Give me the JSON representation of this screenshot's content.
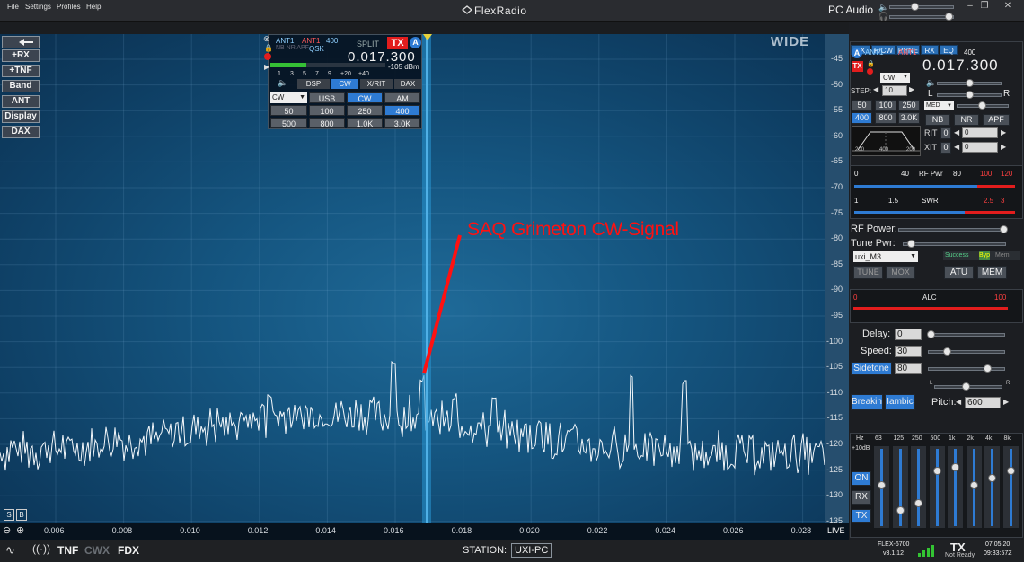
{
  "menu": {
    "file": "File",
    "settings": "Settings",
    "profiles": "Profiles",
    "help": "Help"
  },
  "brand": "FlexRadio",
  "pc_audio": "PC Audio",
  "left_buttons": [
    "+RX",
    "+TNF",
    "Band",
    "ANT",
    "Display",
    "DAX"
  ],
  "panadapter": {
    "mode_label": "WIDE",
    "db_scale": [
      "-45",
      "-50",
      "-55",
      "-60",
      "-65",
      "-70",
      "-75",
      "-80",
      "-85",
      "-90",
      "-95",
      "-100",
      "-105",
      "-110",
      "-115",
      "-120",
      "-125",
      "-130",
      "-135"
    ],
    "freq_axis": [
      "0.006",
      "0.008",
      "0.010",
      "0.012",
      "0.014",
      "0.016",
      "0.018",
      "0.020",
      "0.022",
      "0.024",
      "0.026",
      "0.028"
    ],
    "live": "LIVE",
    "annotation": "SAQ Grimeton CW-Signal",
    "corner_buttons": [
      "S",
      "B"
    ]
  },
  "slice_flag": {
    "ant_rx": "ANT1",
    "ant_tx": "ANT1",
    "filter_width": "400",
    "split": "SPLIT",
    "tx": "TX",
    "letter": "A",
    "indicators": "NB NR APF",
    "qsk": "QSK",
    "frequency": "0.017.300",
    "smeter": "-105 dBm",
    "scale": [
      "1",
      "3",
      "5",
      "7",
      "9",
      "+20",
      "+40"
    ],
    "tabs": [
      "DSP",
      "CW",
      "X/RIT",
      "DAX"
    ],
    "active_tab": "CW",
    "mode_select": "CW",
    "modes": [
      "USB",
      "CW",
      "AM"
    ],
    "active_mode": "CW",
    "filters": [
      "50",
      "100",
      "250",
      "400",
      "500",
      "800",
      "1.0K",
      "3.0K"
    ],
    "active_filter": "400"
  },
  "right_panel": {
    "tabs": [
      "TX",
      "P/CW",
      "PHNE",
      "RX",
      "EQ"
    ],
    "ant_rx": "ANT1",
    "ant_tx": "ANT1",
    "filter_width": "400",
    "letter": "A",
    "tx": "TX",
    "frequency": "0.017.300",
    "mode": "CW",
    "step_label": "STEP:",
    "step_value": "10",
    "agc_label": "MED",
    "pan_l": "L",
    "pan_r": "R",
    "filters": [
      "50",
      "100",
      "250",
      "400",
      "800",
      "3.0K"
    ],
    "active_filter": "400",
    "dsp": [
      "NB",
      "NR",
      "APF"
    ],
    "rit_label": "RIT",
    "rit_on": "0",
    "rit_value": "0",
    "xit_label": "XIT",
    "xit_on": "0",
    "xit_value": "0",
    "filter_graph": [
      "200",
      "400",
      "200"
    ],
    "rfpwr_scale": [
      "0",
      "40",
      "RF Pwr",
      "80",
      "100",
      "120"
    ],
    "swr_scale": [
      "1",
      "1.5",
      "SWR",
      "2.5",
      "3"
    ],
    "rf_power_label": "RF Power:",
    "tune_pwr_label": "Tune Pwr:",
    "profile": "uxi_M3",
    "profile_status": "Success",
    "byp": "Byp",
    "mem": "Mem",
    "tune": "TUNE",
    "mox": "MOX",
    "atu": "ATU",
    "mem_btn": "MEM",
    "alc_min": "0",
    "alc_label": "ALC",
    "alc_max": "100",
    "delay_label": "Delay:",
    "delay_value": "0",
    "speed_label": "Speed:",
    "speed_value": "30",
    "sidetone_btn": "Sidetone",
    "sidetone_value": "80",
    "l": "L",
    "r": "R",
    "breakin": "Breakin",
    "iambic": "Iambic",
    "pitch_label": "Pitch:",
    "pitch_value": "600",
    "eq_hz": "Hz",
    "eq_bands": [
      "63",
      "125",
      "250",
      "500",
      "1k",
      "2k",
      "4k",
      "8k"
    ],
    "eq_db": "+10dB",
    "eq_on": "ON",
    "eq_rx": "RX",
    "eq_tx": "TX",
    "eq_levels": [
      0.55,
      0.2,
      0.3,
      0.75,
      0.8,
      0.55,
      0.65,
      0.75
    ]
  },
  "status": {
    "tnf": "TNF",
    "cwx": "CWX",
    "fdx": "FDX",
    "station_label": "STATION:",
    "station": "UXI-PC",
    "radio": "FLEX-6700",
    "version": "v3.1.12",
    "tx": "TX",
    "tx_state": "Not Ready",
    "date": "07.05.20",
    "time": "09:33:57Z"
  },
  "colors": {
    "accent": "#2e7bd3",
    "tx_red": "#e21d1d",
    "annotation": "#ff1111",
    "marker": "#e8d23a"
  }
}
